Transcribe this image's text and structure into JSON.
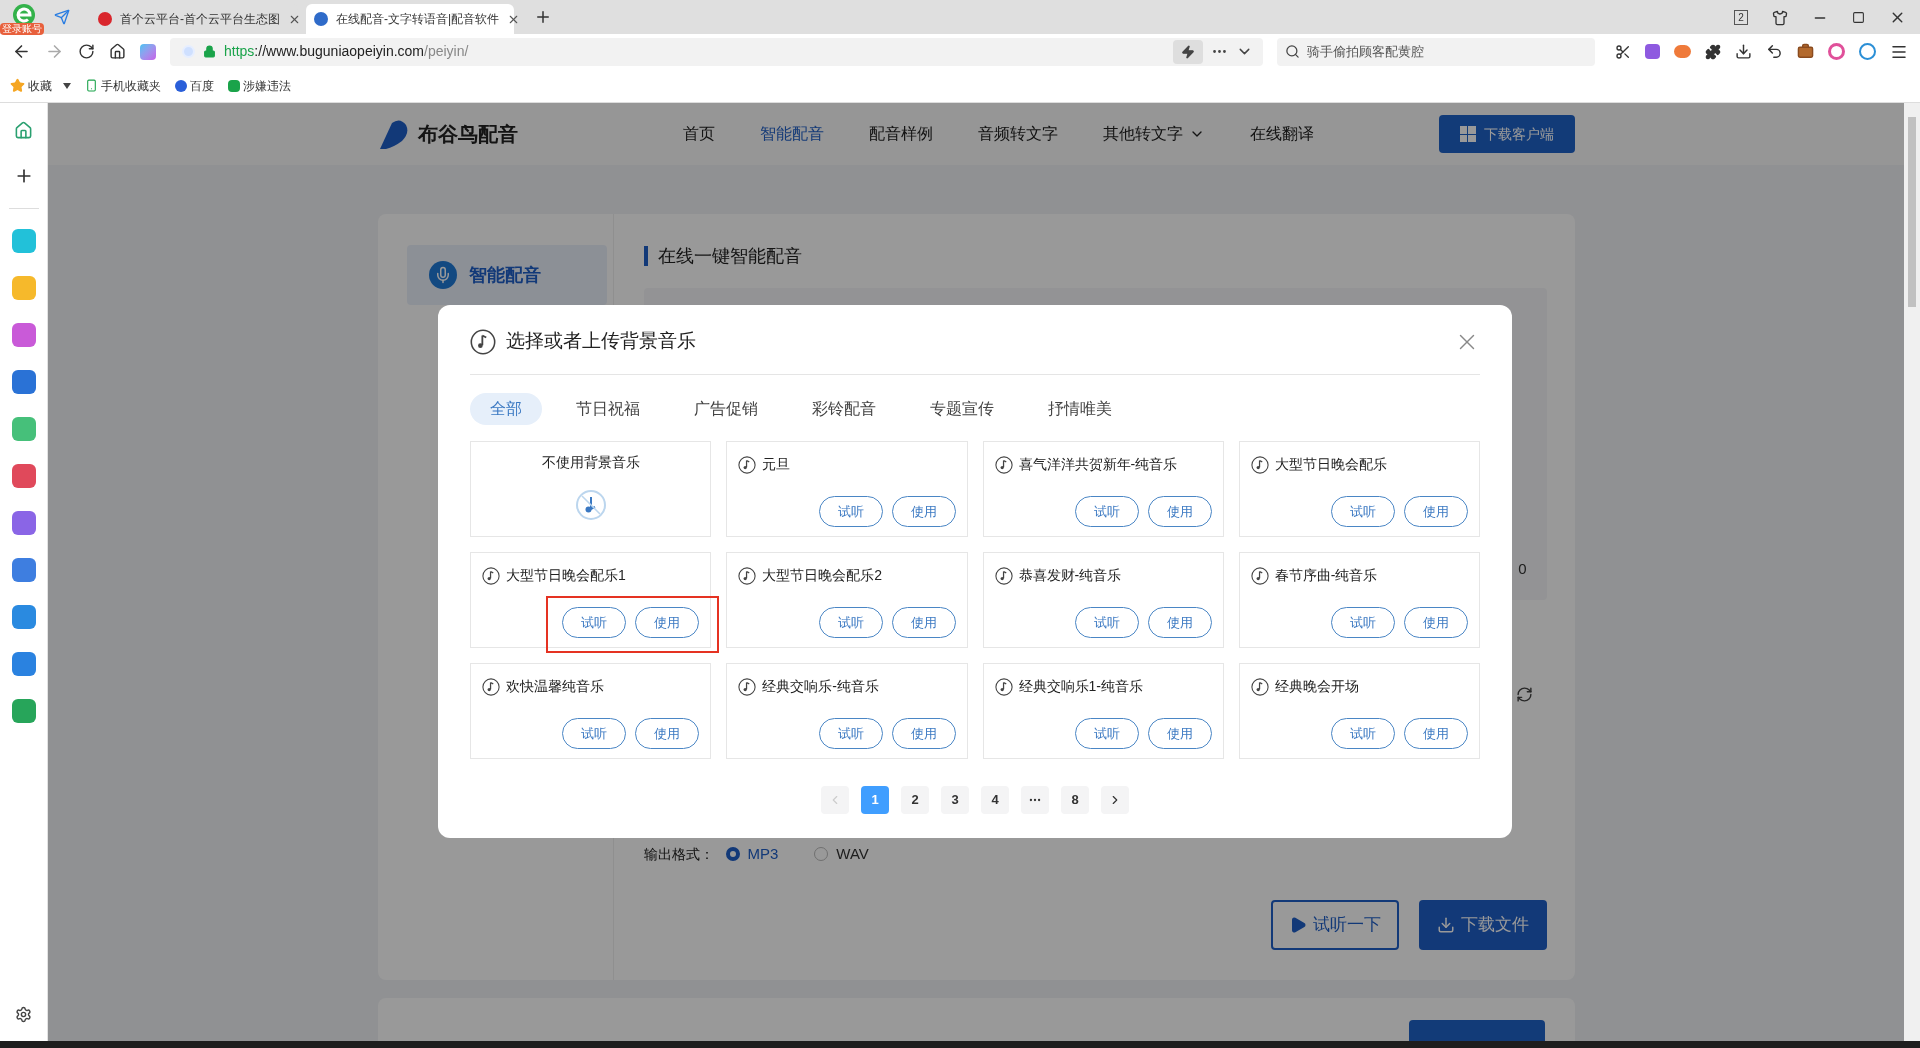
{
  "browser": {
    "account_badge": "登录账号",
    "tabs": [
      {
        "title": "首个云平台-首个云平台生态图",
        "selected": false
      },
      {
        "title": "在线配音-文字转语音|配音软件",
        "selected": true
      }
    ],
    "window_count": "2",
    "url": {
      "scheme": "https",
      "host": "://www.buguniaopeiyin.com",
      "path": "/peiyin/"
    },
    "search": {
      "placeholder": "骑手偷拍顾客配黄腔"
    },
    "bookmarks": [
      "收藏",
      "手机收藏夹",
      "百度",
      "涉嫌违法"
    ]
  },
  "site": {
    "logo": "布谷鸟配音",
    "nav": [
      {
        "label": "首页",
        "selected": false
      },
      {
        "label": "智能配音",
        "selected": true
      },
      {
        "label": "配音样例",
        "selected": false
      },
      {
        "label": "音频转文字",
        "selected": false
      },
      {
        "label": "其他转文字",
        "selected": false,
        "dropdown": true
      },
      {
        "label": "在线翻译",
        "selected": false
      }
    ],
    "download_button": "下载客户端",
    "side_menu": [
      {
        "label": "智能配音",
        "selected": true
      }
    ],
    "heading": "在线一键智能配音",
    "char_count": "0",
    "output_format": {
      "label": "输出格式：",
      "options": [
        {
          "label": "MP3",
          "selected": true
        },
        {
          "label": "WAV",
          "selected": false
        }
      ]
    },
    "actions": {
      "preview": "试听一下",
      "download": "下载文件"
    }
  },
  "dialog": {
    "title": "选择或者上传背景音乐",
    "tabs": [
      {
        "label": "全部",
        "selected": true
      },
      {
        "label": "节日祝福",
        "selected": false
      },
      {
        "label": "广告促销",
        "selected": false
      },
      {
        "label": "彩铃配音",
        "selected": false
      },
      {
        "label": "专题宣传",
        "selected": false
      },
      {
        "label": "抒情唯美",
        "selected": false
      }
    ],
    "items": [
      {
        "kind": "none",
        "title": "不使用背景音乐"
      },
      {
        "kind": "track",
        "title": "元旦",
        "preview": "试听",
        "use": "使用",
        "highlighted": false
      },
      {
        "kind": "track",
        "title": "喜气洋洋共贺新年-纯音乐",
        "preview": "试听",
        "use": "使用",
        "highlighted": false
      },
      {
        "kind": "track",
        "title": "大型节日晚会配乐",
        "preview": "试听",
        "use": "使用",
        "highlighted": false
      },
      {
        "kind": "track",
        "title": "大型节日晚会配乐1",
        "preview": "试听",
        "use": "使用",
        "highlighted": true
      },
      {
        "kind": "track",
        "title": "大型节日晚会配乐2",
        "preview": "试听",
        "use": "使用",
        "highlighted": false
      },
      {
        "kind": "track",
        "title": "恭喜发财-纯音乐",
        "preview": "试听",
        "use": "使用",
        "highlighted": false
      },
      {
        "kind": "track",
        "title": "春节序曲-纯音乐",
        "preview": "试听",
        "use": "使用",
        "highlighted": false
      },
      {
        "kind": "track",
        "title": "欢快温馨纯音乐",
        "preview": "试听",
        "use": "使用",
        "highlighted": false
      },
      {
        "kind": "track",
        "title": "经典交响乐-纯音乐",
        "preview": "试听",
        "use": "使用",
        "highlighted": false
      },
      {
        "kind": "track",
        "title": "经典交响乐1-纯音乐",
        "preview": "试听",
        "use": "使用",
        "highlighted": false
      },
      {
        "kind": "track",
        "title": "经典晚会开场",
        "preview": "试听",
        "use": "使用",
        "highlighted": false
      }
    ],
    "pagination": {
      "prev_disabled": true,
      "pages": [
        {
          "kind": "page",
          "label": "1",
          "selected": true
        },
        {
          "kind": "page",
          "label": "2",
          "selected": false
        },
        {
          "kind": "page",
          "label": "3",
          "selected": false
        },
        {
          "kind": "page",
          "label": "4",
          "selected": false
        },
        {
          "kind": "ellipsis",
          "selected": false
        },
        {
          "kind": "page",
          "label": "8",
          "selected": false
        }
      ]
    }
  }
}
